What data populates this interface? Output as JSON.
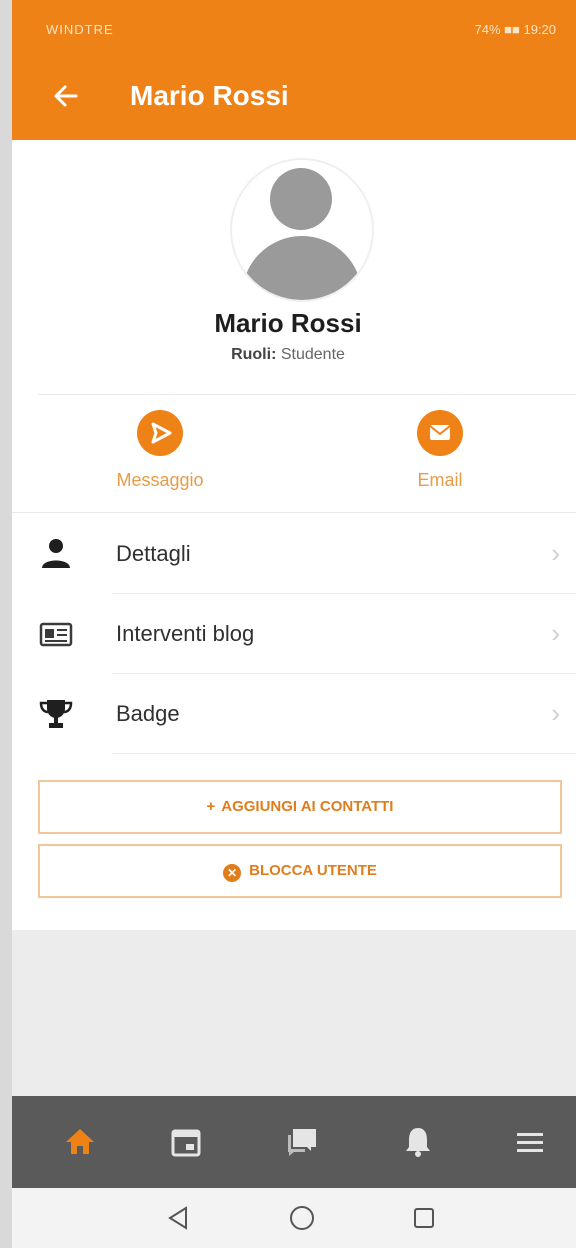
{
  "status_bar": {
    "left_text": "WINDTRE",
    "right_text": "74% ■■ 19:20"
  },
  "app_bar": {
    "back_icon": "arrow-left-icon",
    "title": "Mario Rossi"
  },
  "profile": {
    "name": "Mario Rossi",
    "roles_label": "Ruoli:",
    "roles_value": "Studente"
  },
  "actions": [
    {
      "label": "Messaggio",
      "icon": "send-icon"
    },
    {
      "label": "Email",
      "icon": "mail-icon"
    }
  ],
  "menu": [
    {
      "label": "Dettagli",
      "icon": "person-icon"
    },
    {
      "label": "Interventi blog",
      "icon": "id-card-icon"
    },
    {
      "label": "Badge",
      "icon": "trophy-icon"
    }
  ],
  "buttons": {
    "add_contact": "AGGIUNGI AI CONTATTI",
    "block_user": "BLOCCA UTENTE"
  },
  "bottom_nav": [
    "home-icon",
    "calendar-icon",
    "chat-icon",
    "bell-icon",
    "menu-icon"
  ],
  "system_nav": [
    "back-triangle-icon",
    "home-circle-icon",
    "recents-square-icon"
  ],
  "colors": {
    "accent": "#ef8216",
    "nav_bg": "#5a5a5a"
  }
}
